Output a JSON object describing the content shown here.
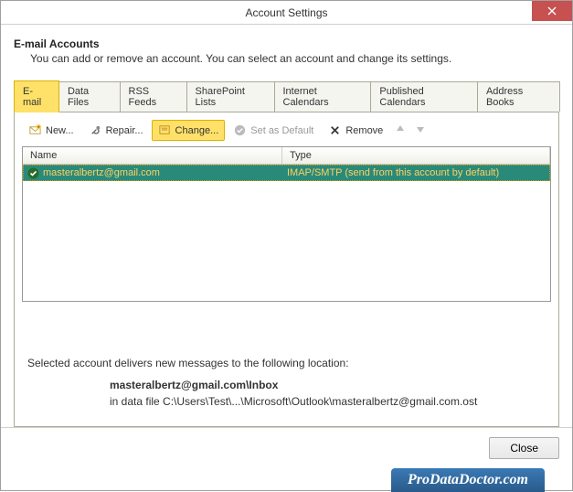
{
  "window": {
    "title": "Account Settings"
  },
  "header": {
    "title": "E-mail Accounts",
    "description": "You can add or remove an account. You can select an account and change its settings."
  },
  "tabs": [
    {
      "label": "E-mail",
      "active": true
    },
    {
      "label": "Data Files"
    },
    {
      "label": "RSS Feeds"
    },
    {
      "label": "SharePoint Lists"
    },
    {
      "label": "Internet Calendars"
    },
    {
      "label": "Published Calendars"
    },
    {
      "label": "Address Books"
    }
  ],
  "toolbar": {
    "new": "New...",
    "repair": "Repair...",
    "change": "Change...",
    "set_default": "Set as Default",
    "remove": "Remove"
  },
  "table": {
    "headers": {
      "name": "Name",
      "type": "Type"
    },
    "rows": [
      {
        "name": "masteralbertz@gmail.com",
        "type": "IMAP/SMTP (send from this account by default)"
      }
    ]
  },
  "delivery": {
    "title": "Selected account delivers new messages to the following location:",
    "location": "masteralbertz@gmail.com\\Inbox",
    "path": "in data file C:\\Users\\Test\\...\\Microsoft\\Outlook\\masteralbertz@gmail.com.ost"
  },
  "footer": {
    "close": "Close"
  },
  "watermark": "ProDataDoctor.com"
}
